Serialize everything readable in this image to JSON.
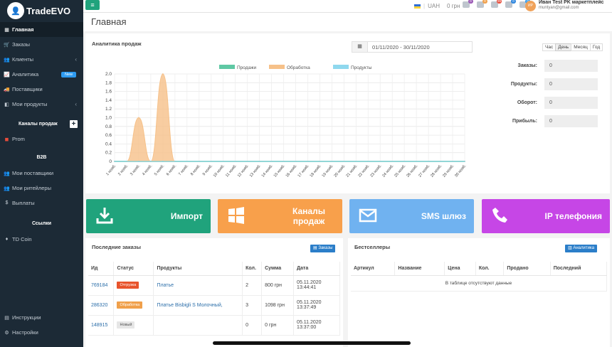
{
  "app": {
    "name": "TradeEVO",
    "logo_icon": "user-avatar-icon"
  },
  "sidebar": {
    "items": [
      {
        "label": "Главная",
        "icon": "grid-icon",
        "active": true
      },
      {
        "label": "Заказы",
        "icon": "cart-icon"
      },
      {
        "label": "Клиенты",
        "icon": "users-icon",
        "chevron": true
      },
      {
        "label": "Аналитика",
        "icon": "chart-icon",
        "badge": "New"
      },
      {
        "label": "Поставщики",
        "icon": "truck-icon"
      },
      {
        "label": "Мои продукты",
        "icon": "box-icon",
        "chevron": true
      }
    ],
    "channels_title": "Каналы продаж",
    "channels": [
      {
        "label": "Prom",
        "icon": "prom-icon"
      }
    ],
    "b2b_title": "B2B",
    "b2b_items": [
      {
        "label": "Мои поставщики",
        "icon": "users-icon"
      },
      {
        "label": "Мои ритейлеры",
        "icon": "users-icon"
      },
      {
        "label": "Выплаты",
        "icon": "dollar-icon"
      }
    ],
    "links_title": "Ссылки",
    "links": [
      {
        "label": "TD Coin",
        "icon": "coin-icon"
      }
    ],
    "bottom": [
      {
        "label": "Инструкции",
        "icon": "book-icon"
      },
      {
        "label": "Настройки",
        "icon": "gear-icon"
      }
    ]
  },
  "topbar": {
    "currency": "UAH",
    "balance": "0 грн",
    "icons": [
      {
        "name": "bell-icon",
        "badge": "0",
        "color": "#9b59b6"
      },
      {
        "name": "message-icon",
        "badge": "0",
        "color": "#f0a04b"
      },
      {
        "name": "cart-icon",
        "badge": "26",
        "color": "#e74c3c"
      },
      {
        "name": "mail-icon",
        "badge": "0",
        "color": "#2e86de"
      },
      {
        "name": "truck-icon",
        "badge": "0",
        "color": "#2e9bf0"
      }
    ],
    "avatar_initials": "ИР",
    "user_name": "Иван Test PK маркетплейс",
    "user_email": "muntyan@gmail.com"
  },
  "page": {
    "title": "Главная"
  },
  "analytics": {
    "title": "Аналитика продаж",
    "date_range": "01/11/2020 - 30/11/2020",
    "periods": [
      "Час",
      "День",
      "Месяц",
      "Год"
    ],
    "active_period": "День",
    "stats": [
      {
        "label": "Заказы:",
        "value": "0"
      },
      {
        "label": "Продукты:",
        "value": "0"
      },
      {
        "label": "Оборот:",
        "value": "0"
      },
      {
        "label": "Прибыль:",
        "value": "0"
      }
    ]
  },
  "chart_data": {
    "type": "area",
    "legend_position": "top",
    "grid": true,
    "categories": [
      "1 нояб.",
      "2 нояб.",
      "3 нояб.",
      "4 нояб.",
      "5 нояб.",
      "6 нояб.",
      "7 нояб.",
      "8 нояб.",
      "9 нояб.",
      "10 нояб.",
      "11 нояб.",
      "12 нояб.",
      "13 нояб.",
      "14 нояб.",
      "15 нояб.",
      "16 нояб.",
      "17 нояб.",
      "18 нояб.",
      "19 нояб.",
      "20 нояб.",
      "21 нояб.",
      "22 нояб.",
      "23 нояб.",
      "24 нояб.",
      "25 нояб.",
      "26 нояб.",
      "27 нояб.",
      "28 нояб.",
      "29 нояб.",
      "30 нояб."
    ],
    "ylim": [
      0,
      2
    ],
    "yticks": [
      "0",
      "0.2",
      "0.4",
      "0.6",
      "0.8",
      "1.0",
      "1.2",
      "1.4",
      "1.6",
      "1.8",
      "2.0"
    ],
    "series": [
      {
        "name": "Продажи",
        "color": "#5fc8a4",
        "values": [
          0,
          0,
          0,
          0,
          0,
          0,
          0,
          0,
          0,
          0,
          0,
          0,
          0,
          0,
          0,
          0,
          0,
          0,
          0,
          0,
          0,
          0,
          0,
          0,
          0,
          0,
          0,
          0,
          0,
          0
        ]
      },
      {
        "name": "Обработка",
        "color": "#f6c189",
        "values": [
          0,
          0,
          1,
          0,
          2,
          0,
          0,
          0,
          0,
          0,
          0,
          0,
          0,
          0,
          0,
          0,
          0,
          0,
          0,
          0,
          0,
          0,
          0,
          0,
          0,
          0,
          0,
          0,
          0,
          0
        ]
      },
      {
        "name": "Продукты",
        "color": "#8fd8ee",
        "values": [
          0,
          0,
          0,
          0,
          0,
          0,
          0,
          0,
          0,
          0,
          0,
          0,
          0,
          0,
          0,
          0,
          0,
          0,
          0,
          0,
          0,
          0,
          0,
          0,
          0,
          0,
          0,
          0,
          0,
          0
        ]
      }
    ]
  },
  "tiles": [
    {
      "label": "Импорт",
      "color": "#20a37c",
      "icon": "download-icon"
    },
    {
      "label": "Каналы продаж",
      "color": "#f8a04b",
      "icon": "windows-icon"
    },
    {
      "label": "SMS шлюз",
      "color": "#70b2f0",
      "icon": "mail-icon"
    },
    {
      "label": "IP телефония",
      "color": "#c646e6",
      "icon": "phone-icon"
    }
  ],
  "orders": {
    "title": "Последние заказы",
    "button": "Заказы",
    "columns": [
      "Ид",
      "Статус",
      "Продукты",
      "Кол.",
      "Сумма",
      "Дата"
    ],
    "rows": [
      {
        "id": "769184",
        "status": "Отгрузка",
        "status_color": "#e8542c",
        "product": "Платье",
        "qty": "2",
        "sum": "800 грн",
        "date": "05.11.2020",
        "time": "13:44:41"
      },
      {
        "id": "286320",
        "status": "Обработка",
        "status_color": "#f0a04b",
        "product": "Платье Bisbigli S Молочный,",
        "qty": "3",
        "sum": "1098 грн",
        "date": "05.11.2020",
        "time": "13:37:49"
      },
      {
        "id": "148915",
        "status": "Новый",
        "status_color": "#e6e6e6",
        "product": "",
        "qty": "0",
        "sum": "0 грн",
        "date": "05.11.2020",
        "time": "13:37:00"
      }
    ]
  },
  "bestsellers": {
    "title": "Бестселлеры",
    "button": "Аналитика",
    "columns": [
      "Артикул",
      "Название",
      "Цена",
      "Кол.",
      "Продано",
      "Последний"
    ],
    "empty": "В таблице отсутствуют данные"
  }
}
